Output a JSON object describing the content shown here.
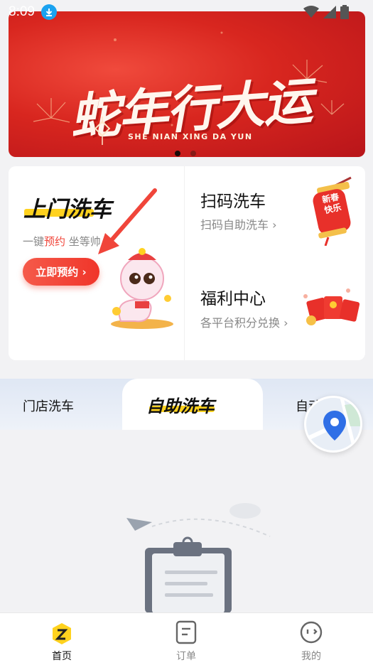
{
  "status_bar": {
    "time": "8:09"
  },
  "banner": {
    "title": "蛇年行大运",
    "subtitle": "SHE NIAN XING DA YUN"
  },
  "home_service": {
    "title": "上门洗车",
    "subtitle_prefix": "一键",
    "subtitle_highlight": "预约",
    "subtitle_suffix": " 坐等帅",
    "button_label": "立即预约 ›"
  },
  "scan_wash": {
    "title": "扫码洗车",
    "subtitle": "扫码自助洗车 ›",
    "lantern_text": "新春快乐"
  },
  "welfare": {
    "title": "福利中心",
    "subtitle": "各平台积分兑换 ›"
  },
  "tabs": [
    {
      "label": "门店洗车"
    },
    {
      "label": "自助洗车"
    },
    {
      "label": "自动"
    }
  ],
  "bottom_nav": [
    {
      "label": "首页"
    },
    {
      "label": "订单"
    },
    {
      "label": "我的"
    }
  ],
  "colors": {
    "accent": "#f0453a",
    "brand_yellow": "#ffd21f",
    "banner_red": "#d8261f"
  }
}
